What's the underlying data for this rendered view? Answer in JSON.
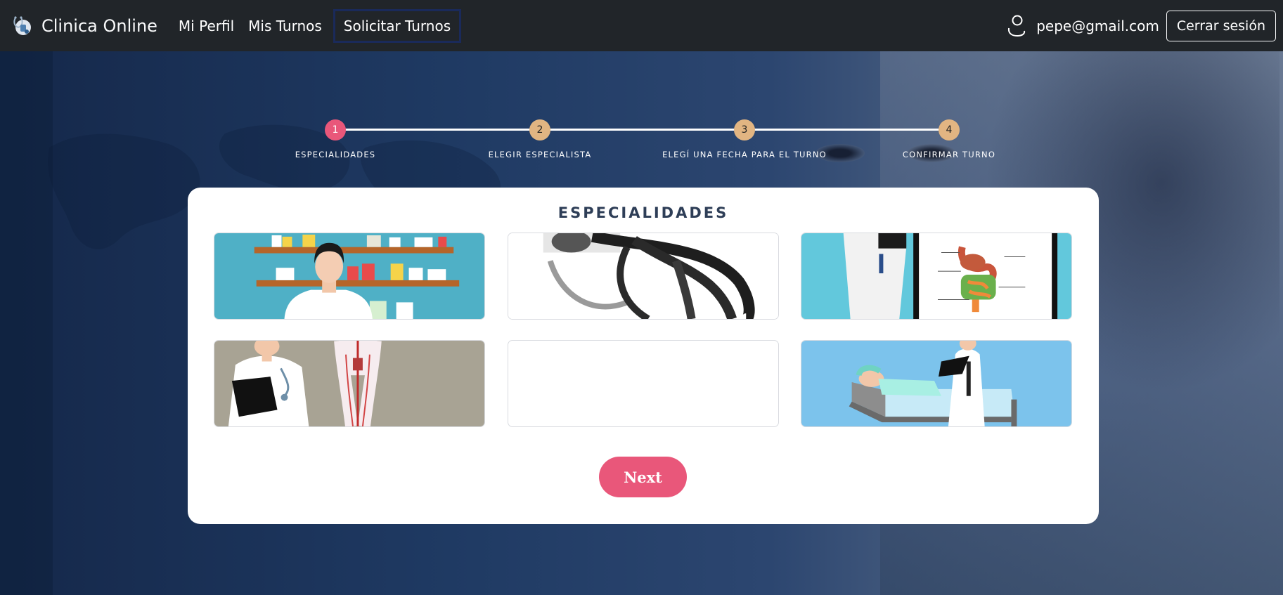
{
  "navbar": {
    "brand": "Clinica Online",
    "links": [
      "Mi Perfil",
      "Mis Turnos",
      "Solicitar Turnos"
    ],
    "active_link": "Solicitar Turnos",
    "user_email": "pepe@gmail.com",
    "logout_label": "Cerrar sesión"
  },
  "stepper": {
    "steps": [
      {
        "number": "1",
        "label": "ESPECIALIDADES",
        "state": "current"
      },
      {
        "number": "2",
        "label": "ELEGIR ESPECIALISTA",
        "state": "pending"
      },
      {
        "number": "3",
        "label": "ELEGÍ UNA FECHA PARA EL TURNO",
        "state": "pending"
      },
      {
        "number": "4",
        "label": "CONFIRMAR TURNO",
        "state": "pending"
      }
    ]
  },
  "card": {
    "title": "ESPECIALIDADES",
    "next_label": "Next"
  },
  "colors": {
    "navbar": "#212529",
    "accent_pink": "#e9577a",
    "step_pending": "#e2b582",
    "card_title": "#2e3e57"
  }
}
